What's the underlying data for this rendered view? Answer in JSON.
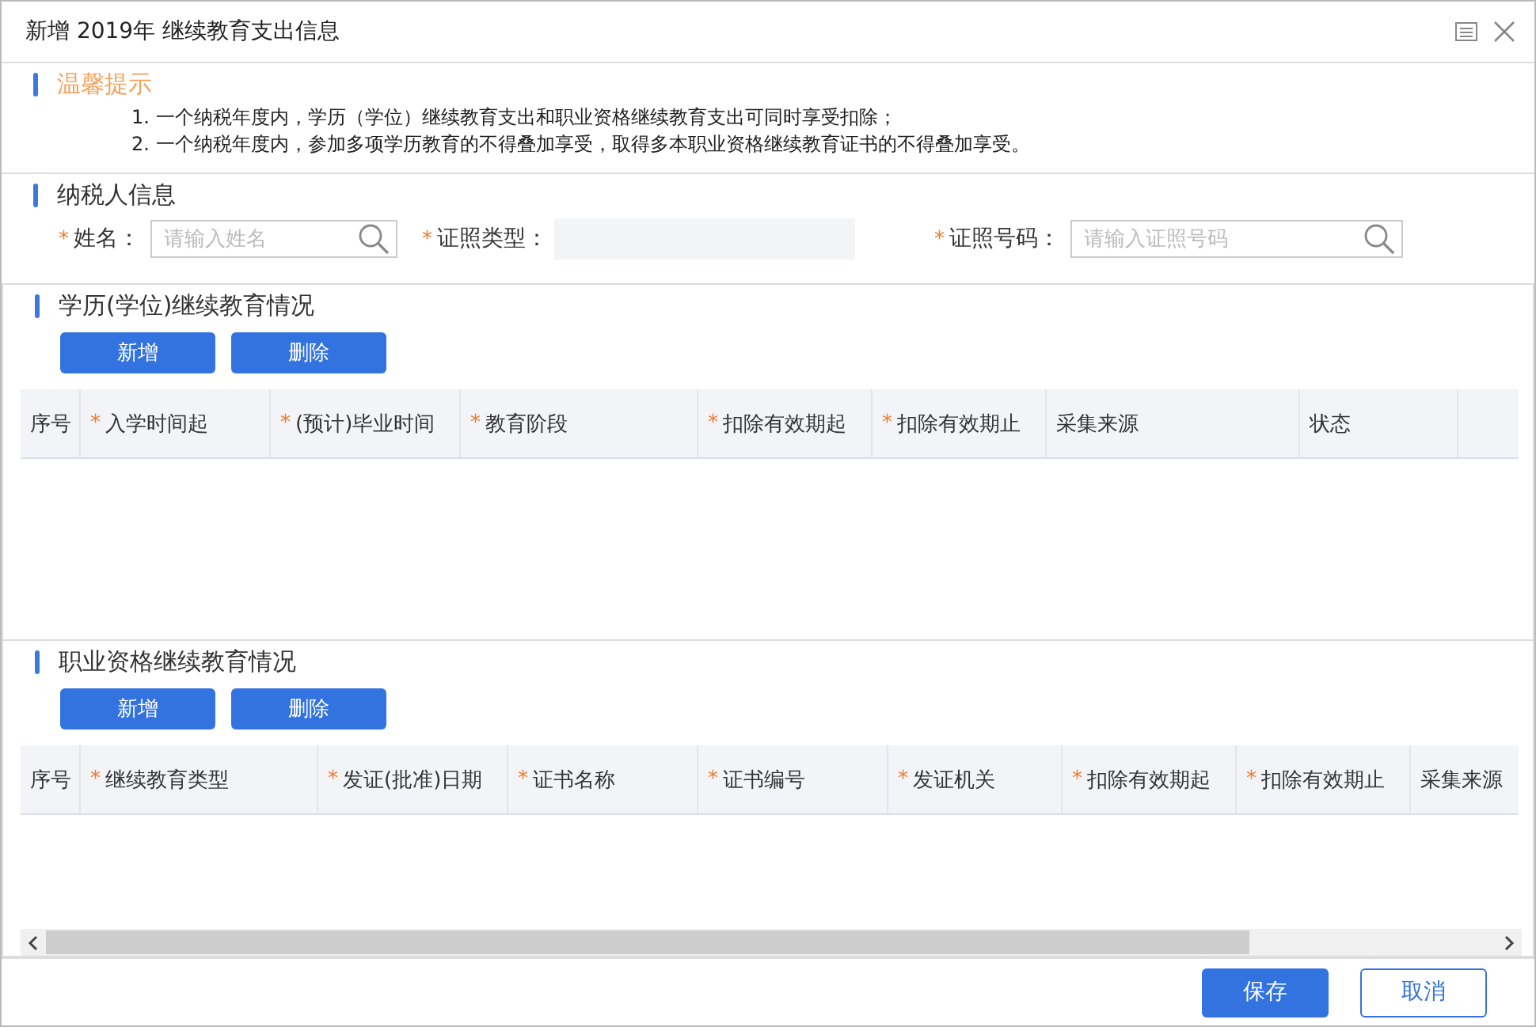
{
  "window": {
    "title": "新增 2019年 继续教育支出信息"
  },
  "tips": {
    "title": "温馨提示",
    "lines": [
      "1. 一个纳税年度内，学历（学位）继续教育支出和职业资格继续教育支出可同时享受扣除；",
      "2. 一个纳税年度内，参加多项学历教育的不得叠加享受，取得多本职业资格继续教育证书的不得叠加享受。"
    ]
  },
  "taxpayer": {
    "title": "纳税人信息",
    "fields": [
      {
        "kind": "search",
        "required_mark": "*",
        "label": "姓名：",
        "placeholder": "请输入姓名"
      },
      {
        "kind": "select",
        "required_mark": "*",
        "label": "证照类型：",
        "disabled": true
      },
      {
        "kind": "search",
        "required_mark": "*",
        "label": "证照号码：",
        "placeholder": "请输入证照号码"
      }
    ]
  },
  "sections": [
    {
      "title": "学历(学位)继续教育情况",
      "buttons": [
        "新增",
        "删除"
      ],
      "columns": [
        {
          "label": "序号"
        },
        {
          "required_mark": "*",
          "label": "入学时间起"
        },
        {
          "required_mark": "*",
          "label": "(预计)毕业时间"
        },
        {
          "required_mark": "*",
          "label": "教育阶段"
        },
        {
          "required_mark": "*",
          "label": "扣除有效期起"
        },
        {
          "required_mark": "*",
          "label": "扣除有效期止"
        },
        {
          "label": "采集来源"
        },
        {
          "label": "状态"
        }
      ]
    },
    {
      "title": "职业资格继续教育情况",
      "buttons": [
        "新增",
        "删除"
      ],
      "scrollbar": true,
      "columns": [
        {
          "label": "序号"
        },
        {
          "required_mark": "*",
          "label": "继续教育类型"
        },
        {
          "required_mark": "*",
          "label": "发证(批准)日期"
        },
        {
          "required_mark": "*",
          "label": "证书名称"
        },
        {
          "required_mark": "*",
          "label": "证书编号"
        },
        {
          "required_mark": "*",
          "label": "发证机关"
        },
        {
          "required_mark": "*",
          "label": "扣除有效期起"
        },
        {
          "required_mark": "*",
          "label": "扣除有效期止"
        },
        {
          "label": "采集来源"
        }
      ]
    }
  ],
  "footer": {
    "buttons": [
      {
        "label": "保存",
        "kind": "primary"
      },
      {
        "label": "取消",
        "kind": "secondary"
      }
    ]
  }
}
